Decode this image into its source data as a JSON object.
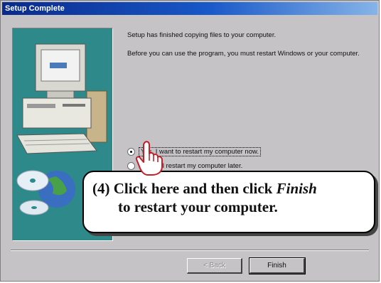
{
  "window": {
    "title": "Setup Complete"
  },
  "message": {
    "line1": "Setup has finished copying files to your computer.",
    "line2": "Before you can use the program, you must restart Windows or your computer."
  },
  "options": [
    {
      "label": "Yes, I want to restart my computer now.",
      "selected": true
    },
    {
      "label": "No, I will restart my computer later.",
      "selected": false
    }
  ],
  "buttons": {
    "back": "< Back",
    "finish": "Finish"
  },
  "callout": {
    "step": "(4) Click here and then click ",
    "emphasis": "Finish",
    "line2": "to restart your computer."
  },
  "colors": {
    "side_panel": "#2e8a8a",
    "title_bar": "#0a2a8c"
  },
  "icons": [
    "computer-illustration-icon",
    "globe-icon",
    "cd-disc-icon",
    "pointing-hand-icon"
  ]
}
